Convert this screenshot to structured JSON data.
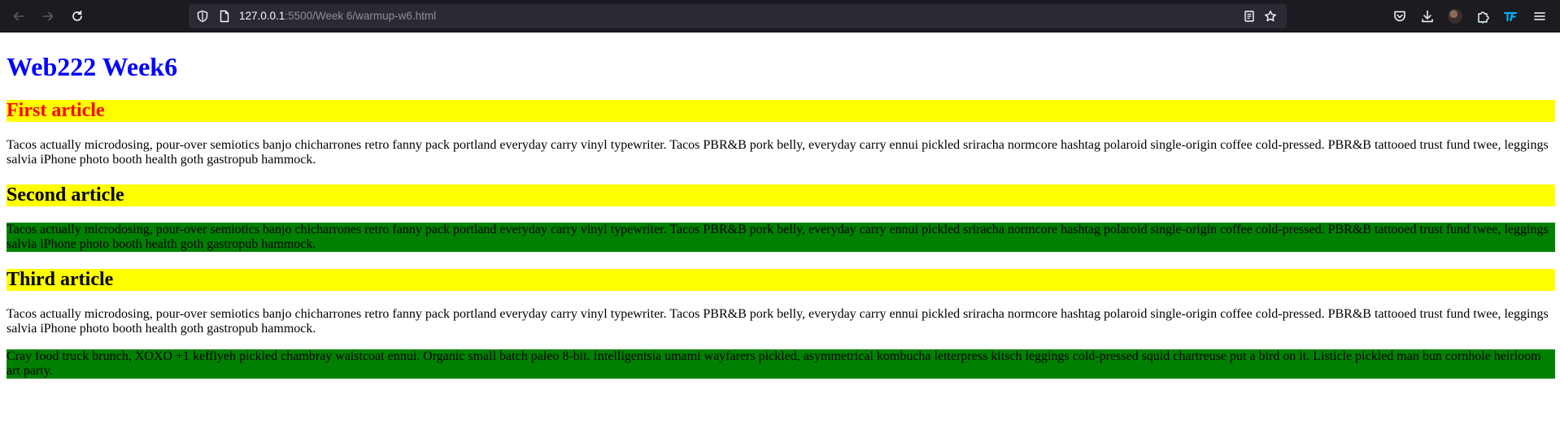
{
  "browser": {
    "url_host": "127.0.0.1",
    "url_path": ":5500/Week 6/warmup-w6.html",
    "icons": [
      "back-icon",
      "forward-icon",
      "reload-icon",
      "shield-icon",
      "page-icon",
      "reader-view-icon",
      "bookmark-star-icon",
      "pocket-icon",
      "downloads-icon",
      "account-avatar",
      "extensions-icon",
      "extension-tf-icon",
      "menu-icon"
    ]
  },
  "page": {
    "title": "Web222 Week6",
    "articles": [
      {
        "heading": "First article",
        "paragraph": "Tacos actually microdosing, pour-over semiotics banjo chicharrones retro fanny pack portland everyday carry vinyl typewriter. Tacos PBR&B pork belly, everyday carry ennui pickled sriracha normcore hashtag polaroid single-origin coffee cold-pressed. PBR&B tattooed trust fund twee, leggings salvia iPhone photo booth health goth gastropub hammock."
      },
      {
        "heading": "Second article",
        "paragraph": "Tacos actually microdosing, pour-over semiotics banjo chicharrones retro fanny pack portland everyday carry vinyl typewriter. Tacos PBR&B pork belly, everyday carry ennui pickled sriracha normcore hashtag polaroid single-origin coffee cold-pressed. PBR&B tattooed trust fund twee, leggings salvia iPhone photo booth health goth gastropub hammock."
      },
      {
        "heading": "Third article",
        "paragraph": "Tacos actually microdosing, pour-over semiotics banjo chicharrones retro fanny pack portland everyday carry vinyl typewriter. Tacos PBR&B pork belly, everyday carry ennui pickled sriracha normcore hashtag polaroid single-origin coffee cold-pressed. PBR&B tattooed trust fund twee, leggings salvia iPhone photo booth health goth gastropub hammock.",
        "extra_paragraph": "Cray food truck brunch, XOXO +1 keffiyeh pickled chambray waistcoat ennui. Organic small batch paleo 8-bit. Intelligentsia umami wayfarers pickled, asymmetrical kombucha letterpress kitsch leggings cold-pressed squid chartreuse put a bird on it. Listicle pickled man bun cornhole heirloom art party."
      }
    ]
  },
  "colors": {
    "title": "#0000ff",
    "heading_bg": "#ffff00",
    "first_heading_text": "#ff0000",
    "green_paragraph_bg": "#008000",
    "toolbar_bg": "#1c1b22",
    "urlbar_bg": "#2b2a33"
  }
}
